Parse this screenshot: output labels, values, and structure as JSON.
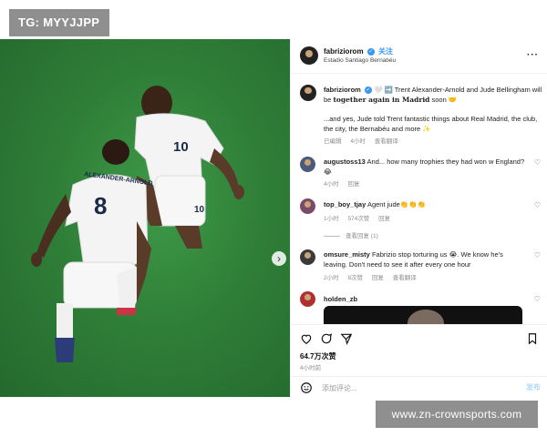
{
  "watermark_top": "TG: MYYJJPP",
  "watermark_bottom": "www.zn-crownsports.com",
  "photo": {
    "players": [
      {
        "name": "ALEXANDER-ARNOLD",
        "number": "8"
      },
      {
        "name": "",
        "number": "10"
      }
    ],
    "carousel_dots": 8,
    "active_dot": 0
  },
  "header": {
    "username": "fabriziorom",
    "follow_label": "关注",
    "location": "Estadio Santiago Bernabéu",
    "more_icon": "more-icon"
  },
  "caption": {
    "username": "fabriziorom",
    "text_pre": "🤍 ➡️ Trent Alexander-Arnold and Jude Bellingham will be",
    "text_bold": "together again in Madrid",
    "text_post": "soon 🤝",
    "text_2": "...and yes, Jude told Trent fantastic things about Real Madrid, the club, the city, the Bernabéu and more ✨",
    "meta_edited": "已编辑",
    "meta_time": "4小时",
    "meta_translate": "查看翻译"
  },
  "comments": [
    {
      "username": "augustoss13",
      "text": "And... how many trophies they had won w England? 😂",
      "time": "4小时",
      "likes": "",
      "reply": "回复"
    },
    {
      "username": "top_boy_tjay",
      "text": "Agent jude👏👏👏",
      "time": "1小时",
      "likes": "574次赞",
      "reply": "回复",
      "view_replies": "查看回复 (1)"
    },
    {
      "username": "omsure_misty",
      "text": "Fabrizio stop torturing us 😭. We know he's leaving. Don't need to see it after every one hour",
      "time": "2小时",
      "likes": "8次赞",
      "reply": "回复",
      "translate": "查看翻译"
    },
    {
      "username": "holden_zb",
      "text": ""
    }
  ],
  "actions": {
    "likes": "64.7万次赞",
    "post_time": "4小时前",
    "comment_placeholder": "添加评论...",
    "post_label": "发布"
  },
  "colors": {
    "accent": "#3897f0",
    "grass": "#2f7f38"
  }
}
